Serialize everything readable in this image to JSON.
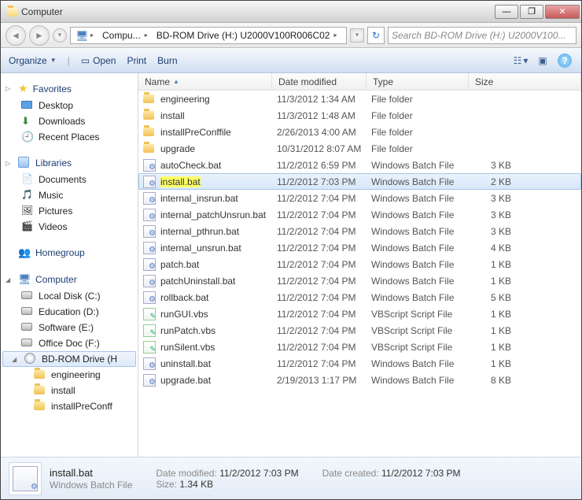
{
  "window": {
    "title": "Computer"
  },
  "breadcrumb": {
    "root_icon": "computer",
    "parts": [
      "Compu...",
      "BD-ROM Drive (H:) U2000V100R006C02"
    ],
    "search_placeholder": "Search BD-ROM Drive (H:) U2000V100..."
  },
  "toolbar": {
    "organize": "Organize",
    "open": "Open",
    "print": "Print",
    "burn": "Burn"
  },
  "nav": {
    "favorites": {
      "header": "Favorites",
      "items": [
        "Desktop",
        "Downloads",
        "Recent Places"
      ]
    },
    "libraries": {
      "header": "Libraries",
      "items": [
        "Documents",
        "Music",
        "Pictures",
        "Videos"
      ]
    },
    "homegroup": {
      "header": "Homegroup"
    },
    "computer": {
      "header": "Computer",
      "items": [
        "Local Disk (C:)",
        "Education (D:)",
        "Software (E:)",
        "Office Doc (F:)"
      ],
      "bdrom": "BD-ROM Drive (H",
      "bdrom_children": [
        "engineering",
        "install",
        "installPreConff"
      ]
    }
  },
  "columns": {
    "name": "Name",
    "date": "Date modified",
    "type": "Type",
    "size": "Size"
  },
  "files": [
    {
      "name": "engineering",
      "date": "11/3/2012 1:34 AM",
      "type": "File folder",
      "size": "",
      "icon": "folder"
    },
    {
      "name": "install",
      "date": "11/3/2012 1:48 AM",
      "type": "File folder",
      "size": "",
      "icon": "folder"
    },
    {
      "name": "installPreConffile",
      "date": "2/26/2013 4:00 AM",
      "type": "File folder",
      "size": "",
      "icon": "folder"
    },
    {
      "name": "upgrade",
      "date": "10/31/2012 8:07 AM",
      "type": "File folder",
      "size": "",
      "icon": "folder"
    },
    {
      "name": "autoCheck.bat",
      "date": "11/2/2012 6:59 PM",
      "type": "Windows Batch File",
      "size": "3 KB",
      "icon": "bat"
    },
    {
      "name": "install.bat",
      "date": "11/2/2012 7:03 PM",
      "type": "Windows Batch File",
      "size": "2 KB",
      "icon": "bat",
      "selected": true,
      "highlight": true
    },
    {
      "name": "internal_insrun.bat",
      "date": "11/2/2012 7:04 PM",
      "type": "Windows Batch File",
      "size": "3 KB",
      "icon": "bat"
    },
    {
      "name": "internal_patchUnsrun.bat",
      "date": "11/2/2012 7:04 PM",
      "type": "Windows Batch File",
      "size": "3 KB",
      "icon": "bat"
    },
    {
      "name": "internal_pthrun.bat",
      "date": "11/2/2012 7:04 PM",
      "type": "Windows Batch File",
      "size": "3 KB",
      "icon": "bat"
    },
    {
      "name": "internal_unsrun.bat",
      "date": "11/2/2012 7:04 PM",
      "type": "Windows Batch File",
      "size": "4 KB",
      "icon": "bat"
    },
    {
      "name": "patch.bat",
      "date": "11/2/2012 7:04 PM",
      "type": "Windows Batch File",
      "size": "1 KB",
      "icon": "bat"
    },
    {
      "name": "patchUninstall.bat",
      "date": "11/2/2012 7:04 PM",
      "type": "Windows Batch File",
      "size": "1 KB",
      "icon": "bat"
    },
    {
      "name": "rollback.bat",
      "date": "11/2/2012 7:04 PM",
      "type": "Windows Batch File",
      "size": "5 KB",
      "icon": "bat"
    },
    {
      "name": "runGUI.vbs",
      "date": "11/2/2012 7:04 PM",
      "type": "VBScript Script File",
      "size": "1 KB",
      "icon": "vbs"
    },
    {
      "name": "runPatch.vbs",
      "date": "11/2/2012 7:04 PM",
      "type": "VBScript Script File",
      "size": "1 KB",
      "icon": "vbs"
    },
    {
      "name": "runSilent.vbs",
      "date": "11/2/2012 7:04 PM",
      "type": "VBScript Script File",
      "size": "1 KB",
      "icon": "vbs"
    },
    {
      "name": "uninstall.bat",
      "date": "11/2/2012 7:04 PM",
      "type": "Windows Batch File",
      "size": "1 KB",
      "icon": "bat"
    },
    {
      "name": "upgrade.bat",
      "date": "2/19/2013 1:17 PM",
      "type": "Windows Batch File",
      "size": "8 KB",
      "icon": "bat"
    }
  ],
  "details": {
    "name": "install.bat",
    "type": "Windows Batch File",
    "date_modified_label": "Date modified:",
    "date_modified": "11/2/2012 7:03 PM",
    "size_label": "Size:",
    "size": "1.34 KB",
    "date_created_label": "Date created:",
    "date_created": "11/2/2012 7:03 PM"
  }
}
